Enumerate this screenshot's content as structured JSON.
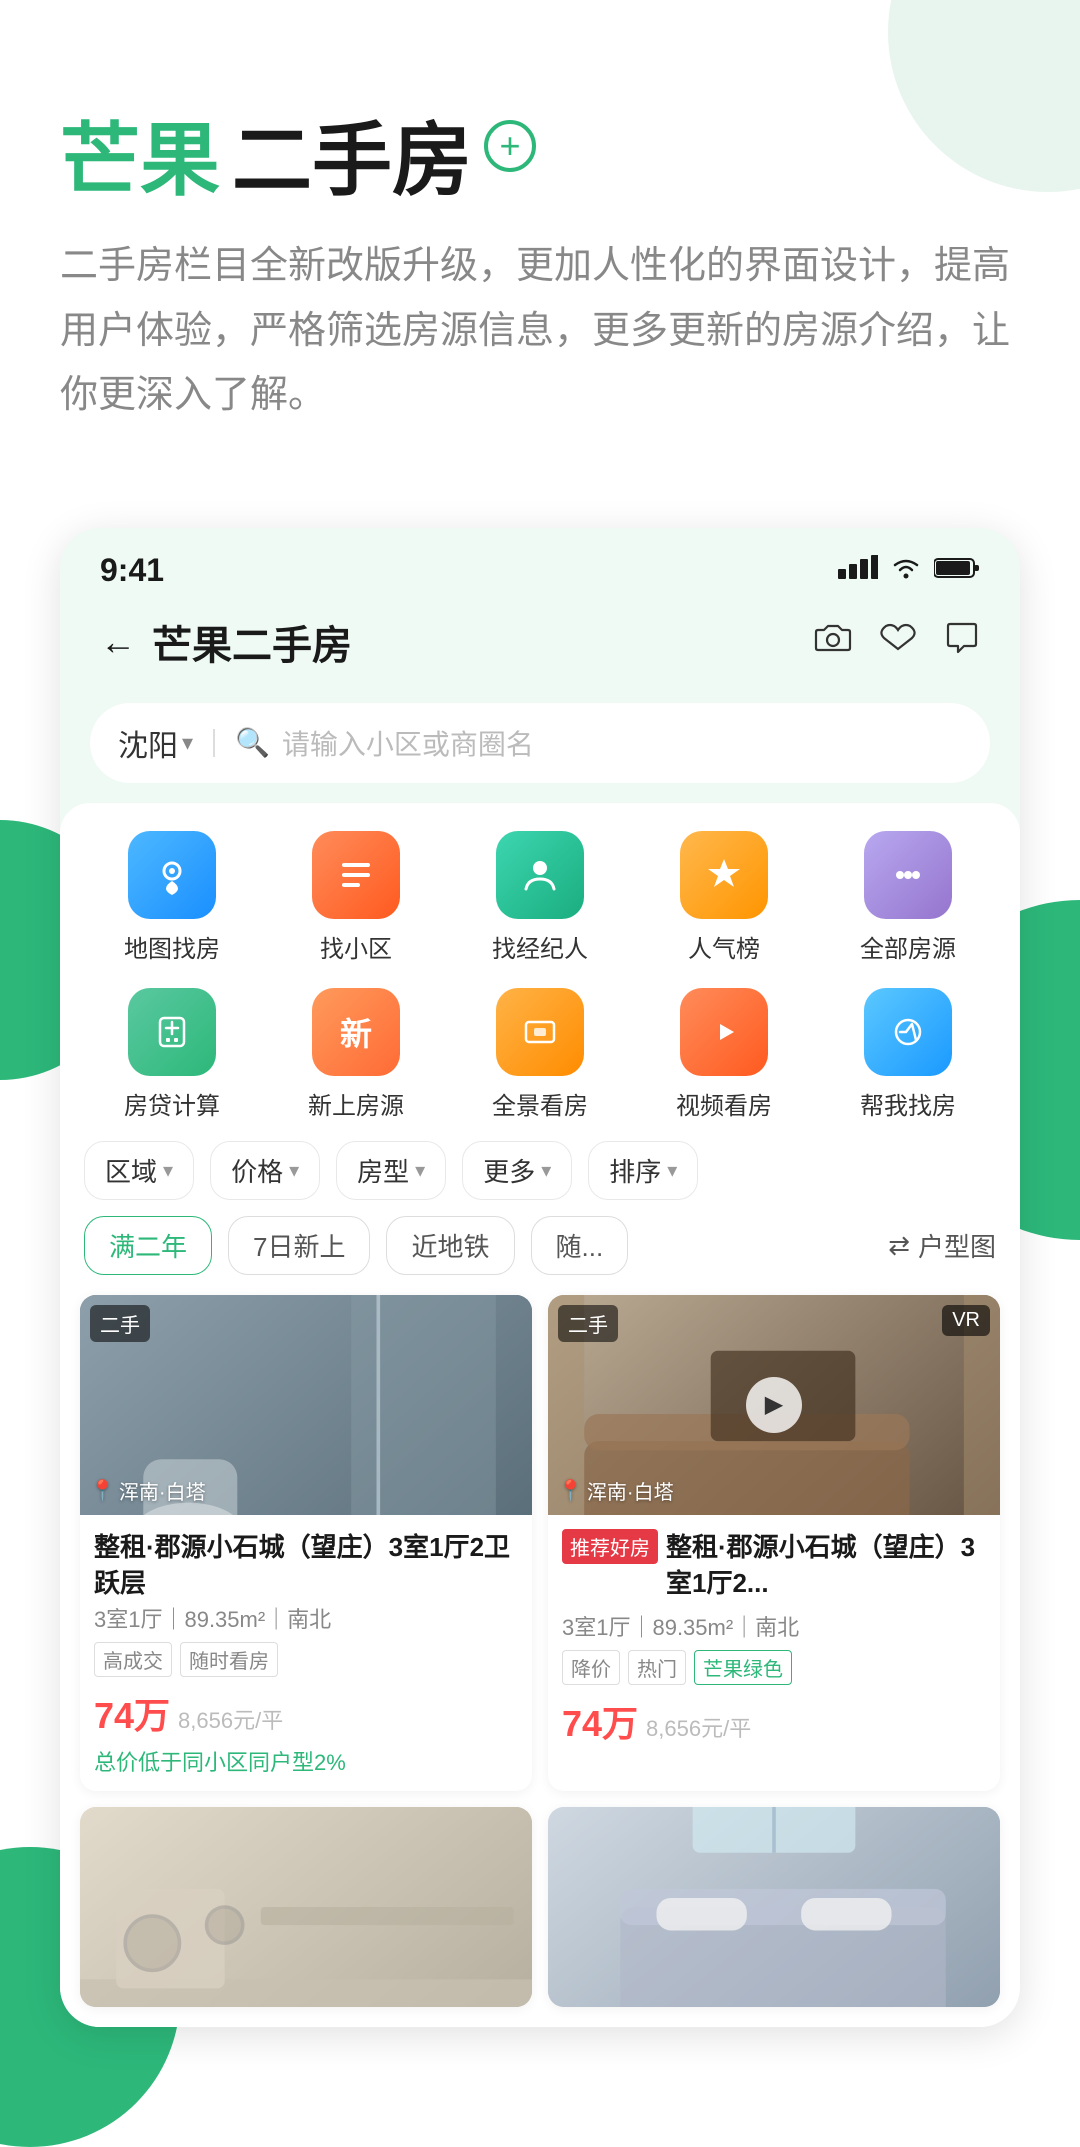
{
  "app": {
    "title_green": "芒果",
    "title_rest": "二手房",
    "plus_icon": "+",
    "description": "二手房栏目全新改版升级，更加人性化的界面设计，提高用户体验，严格筛选房源信息，更多更新的房源介绍，让你更深入了解。"
  },
  "phone": {
    "status_bar": {
      "time": "9:41",
      "signal": "▪▪▪",
      "wifi": "wifi",
      "battery": "battery"
    },
    "nav": {
      "back": "←",
      "title": "芒果二手房",
      "icons": [
        "camera",
        "heart",
        "message"
      ]
    },
    "search": {
      "location": "沈阳",
      "dropdown": "▾",
      "placeholder": "请输入小区或商圈名"
    },
    "quick_menu_row1": [
      {
        "label": "地图找房",
        "icon": "📍",
        "color_class": "icon-blue"
      },
      {
        "label": "找小区",
        "icon": "≡",
        "color_class": "icon-orange"
      },
      {
        "label": "找经纪人",
        "icon": "👔",
        "color_class": "icon-teal"
      },
      {
        "label": "人气榜",
        "icon": "🏆",
        "color_class": "icon-yellow"
      },
      {
        "label": "全部房源",
        "icon": "⋯",
        "color_class": "icon-purple"
      }
    ],
    "quick_menu_row2": [
      {
        "label": "房贷计算",
        "icon": "±",
        "color_class": "icon-green-calc"
      },
      {
        "label": "新上房源",
        "icon": "新",
        "color_class": "icon-orange-new"
      },
      {
        "label": "全景看房",
        "icon": "⊡",
        "color_class": "icon-orange-pan"
      },
      {
        "label": "视频看房",
        "icon": "▶",
        "color_class": "icon-orange-vid"
      },
      {
        "label": "帮我找房",
        "icon": "🔍",
        "color_class": "icon-blue-help"
      }
    ],
    "filters": [
      {
        "label": "区域"
      },
      {
        "label": "价格"
      },
      {
        "label": "房型"
      },
      {
        "label": "更多"
      },
      {
        "label": "排序"
      }
    ],
    "tags": [
      {
        "label": "满二年",
        "active": true
      },
      {
        "label": "7日新上",
        "active": false
      },
      {
        "label": "近地铁",
        "active": false
      },
      {
        "label": "随...",
        "active": false
      }
    ],
    "floor_plan_toggle": "户型图",
    "listings": [
      {
        "id": 1,
        "badge_type": "二手",
        "location": "浑南·白塔",
        "title": "整租·郡源小石城（望庄）3室1厅2卫 跃层",
        "specs": "3室1厅｜89.35m²｜南北",
        "tags": [
          "高成交",
          "随时看房"
        ],
        "price": "74万",
        "per_sqm": "8,656元/平",
        "note": "总价低于同小区同户型2%",
        "recommend": false,
        "has_vr": false,
        "has_play": false,
        "img_class": "img-bathroom"
      },
      {
        "id": 2,
        "badge_type": "二手",
        "location": "浑南·白塔",
        "title": "整租·郡源小石城（望庄）3室1厅2...",
        "specs": "3室1厅｜89.35m²｜南北",
        "tags": [
          "降价",
          "热门",
          "芒果绿色"
        ],
        "price": "74万",
        "per_sqm": "8,656元/平",
        "note": "",
        "recommend": true,
        "recommend_text": "推荐好房",
        "has_vr": true,
        "has_play": true,
        "img_class": "img-living"
      },
      {
        "id": 3,
        "badge_type": "",
        "location": "",
        "title": "",
        "specs": "",
        "tags": [],
        "price": "",
        "per_sqm": "",
        "note": "",
        "recommend": false,
        "has_vr": false,
        "has_play": false,
        "img_class": "img-kitchen",
        "partial": true
      },
      {
        "id": 4,
        "badge_type": "",
        "location": "",
        "title": "",
        "specs": "",
        "tags": [],
        "price": "",
        "per_sqm": "",
        "note": "",
        "recommend": false,
        "has_vr": false,
        "has_play": false,
        "img_class": "img-bedroom",
        "partial": true
      }
    ]
  }
}
